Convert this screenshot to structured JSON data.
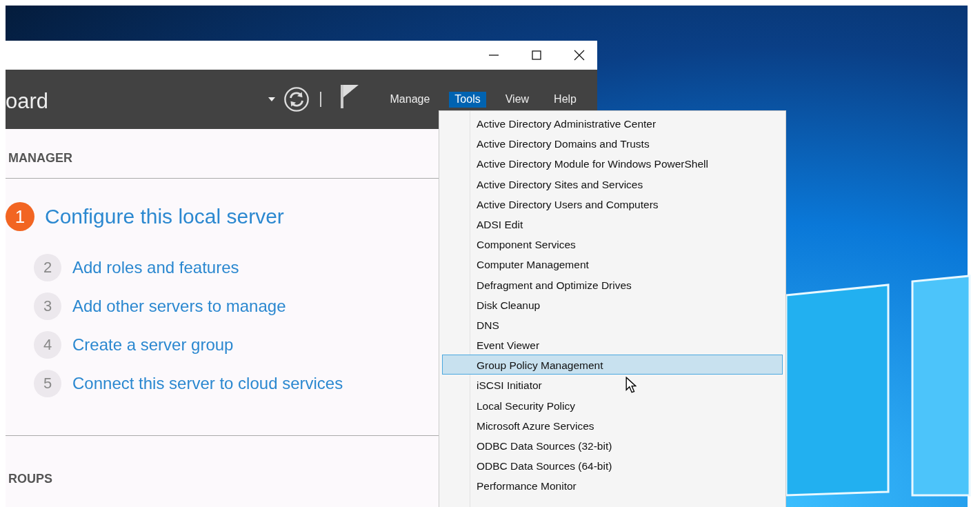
{
  "header": {
    "title": "oard",
    "menus": [
      {
        "label": "Manage",
        "selected": false
      },
      {
        "label": "Tools",
        "selected": true
      },
      {
        "label": "View",
        "selected": false
      },
      {
        "label": "Help",
        "selected": false
      }
    ]
  },
  "section_title": "MANAGER",
  "quick_start": {
    "main": {
      "number": "1",
      "label": "Configure this local server"
    },
    "steps": [
      {
        "number": "2",
        "label": "Add roles and features"
      },
      {
        "number": "3",
        "label": "Add other servers to manage"
      },
      {
        "number": "4",
        "label": "Create a server group"
      },
      {
        "number": "5",
        "label": "Connect this server to cloud services"
      }
    ]
  },
  "groups_title": "ROUPS",
  "tools_menu": {
    "items": [
      {
        "label": "Active Directory Administrative Center",
        "selected": false
      },
      {
        "label": "Active Directory Domains and Trusts",
        "selected": false
      },
      {
        "label": "Active Directory Module for Windows PowerShell",
        "selected": false
      },
      {
        "label": "Active Directory Sites and Services",
        "selected": false
      },
      {
        "label": "Active Directory Users and Computers",
        "selected": false
      },
      {
        "label": "ADSI Edit",
        "selected": false
      },
      {
        "label": "Component Services",
        "selected": false
      },
      {
        "label": "Computer Management",
        "selected": false
      },
      {
        "label": "Defragment and Optimize Drives",
        "selected": false
      },
      {
        "label": "Disk Cleanup",
        "selected": false
      },
      {
        "label": "DNS",
        "selected": false
      },
      {
        "label": "Event Viewer",
        "selected": false
      },
      {
        "label": "Group Policy Management",
        "selected": true
      },
      {
        "label": "iSCSI Initiator",
        "selected": false
      },
      {
        "label": "Local Security Policy",
        "selected": false
      },
      {
        "label": "Microsoft Azure Services",
        "selected": false
      },
      {
        "label": "ODBC Data Sources (32-bit)",
        "selected": false
      },
      {
        "label": "ODBC Data Sources (64-bit)",
        "selected": false
      },
      {
        "label": "Performance Monitor",
        "selected": false
      }
    ]
  }
}
